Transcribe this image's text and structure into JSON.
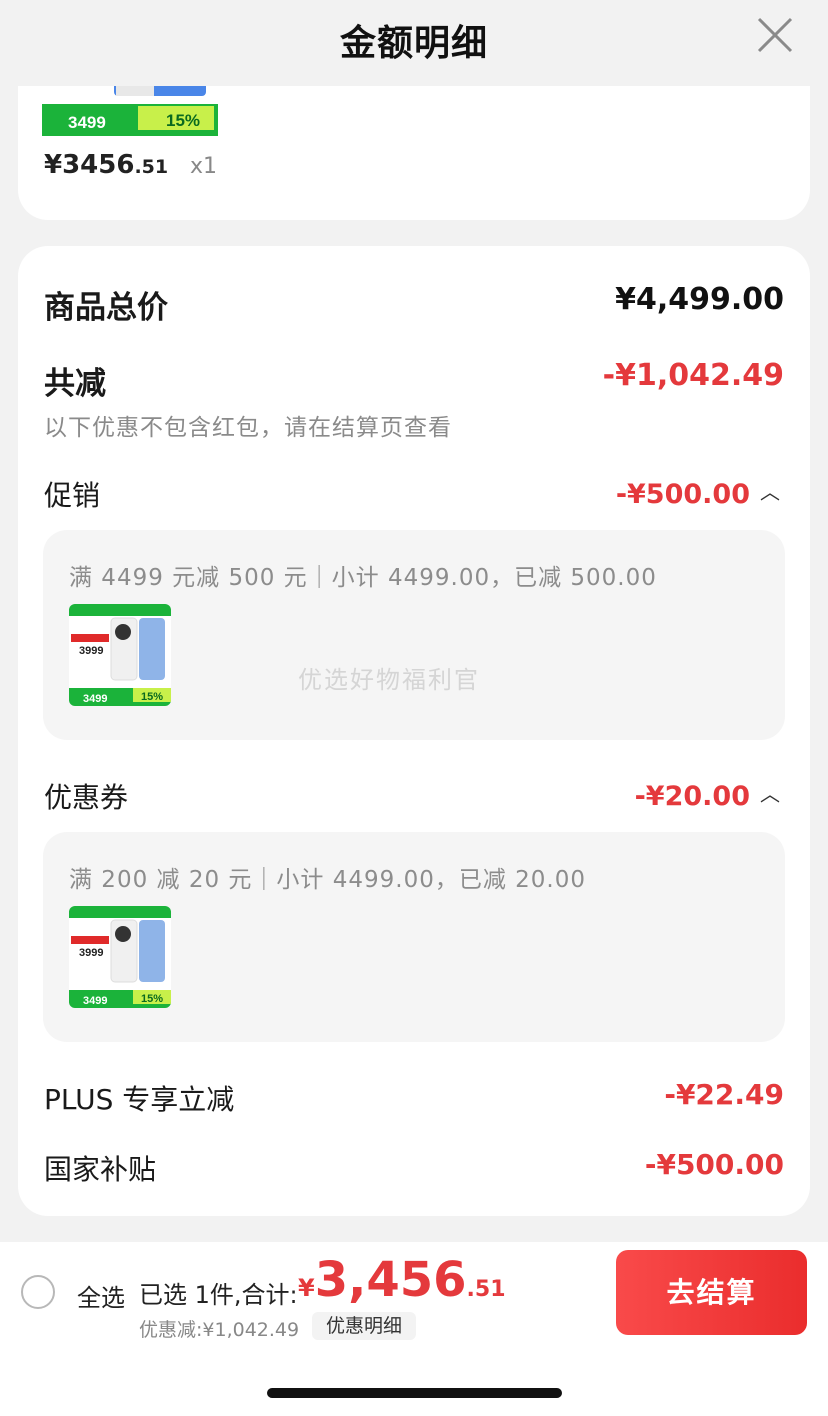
{
  "header": {
    "title": "金额明细"
  },
  "top_product": {
    "price_int": "¥3456",
    "price_dec": ".51",
    "qty": "x1",
    "thumb_price": "3499",
    "thumb_percent": "15%"
  },
  "summary": {
    "total_label": "商品总价",
    "total_value": "¥4,499.00",
    "reduce_label": "共减",
    "reduce_value": "-¥1,042.49",
    "note": "以下优惠不包含红包，请在结算页查看"
  },
  "promotion": {
    "label": "促销",
    "value": "-¥500.00",
    "desc": "满 4499 元减 500 元｜小计 4499.00，已减 500.00",
    "watermark": "优选好物福利官",
    "thumb_price": "3499",
    "thumb_percent": "15%",
    "thumb_model": "3999"
  },
  "coupon": {
    "label": "优惠券",
    "value": "-¥20.00",
    "desc": "满 200 减 20 元｜小计 4499.00，已减 20.00",
    "thumb_price": "3499",
    "thumb_percent": "15%",
    "thumb_model": "3999"
  },
  "plus": {
    "label": "PLUS 专享立减",
    "value": "-¥22.49"
  },
  "subsidy": {
    "label": "国家补贴",
    "value": "-¥500.00"
  },
  "bottom": {
    "select_all": "全选",
    "selected_info": "已选 1件,合计:",
    "total_currency": "¥",
    "total_int": "3,456",
    "total_dec": ".51",
    "discount_text": "优惠减:¥1,042.49",
    "detail_link": "优惠明细",
    "checkout": "去结算"
  },
  "colors": {
    "accent": "#e4393c",
    "thumb_green": "#1bb33a",
    "thumb_red": "#e02a2a"
  }
}
